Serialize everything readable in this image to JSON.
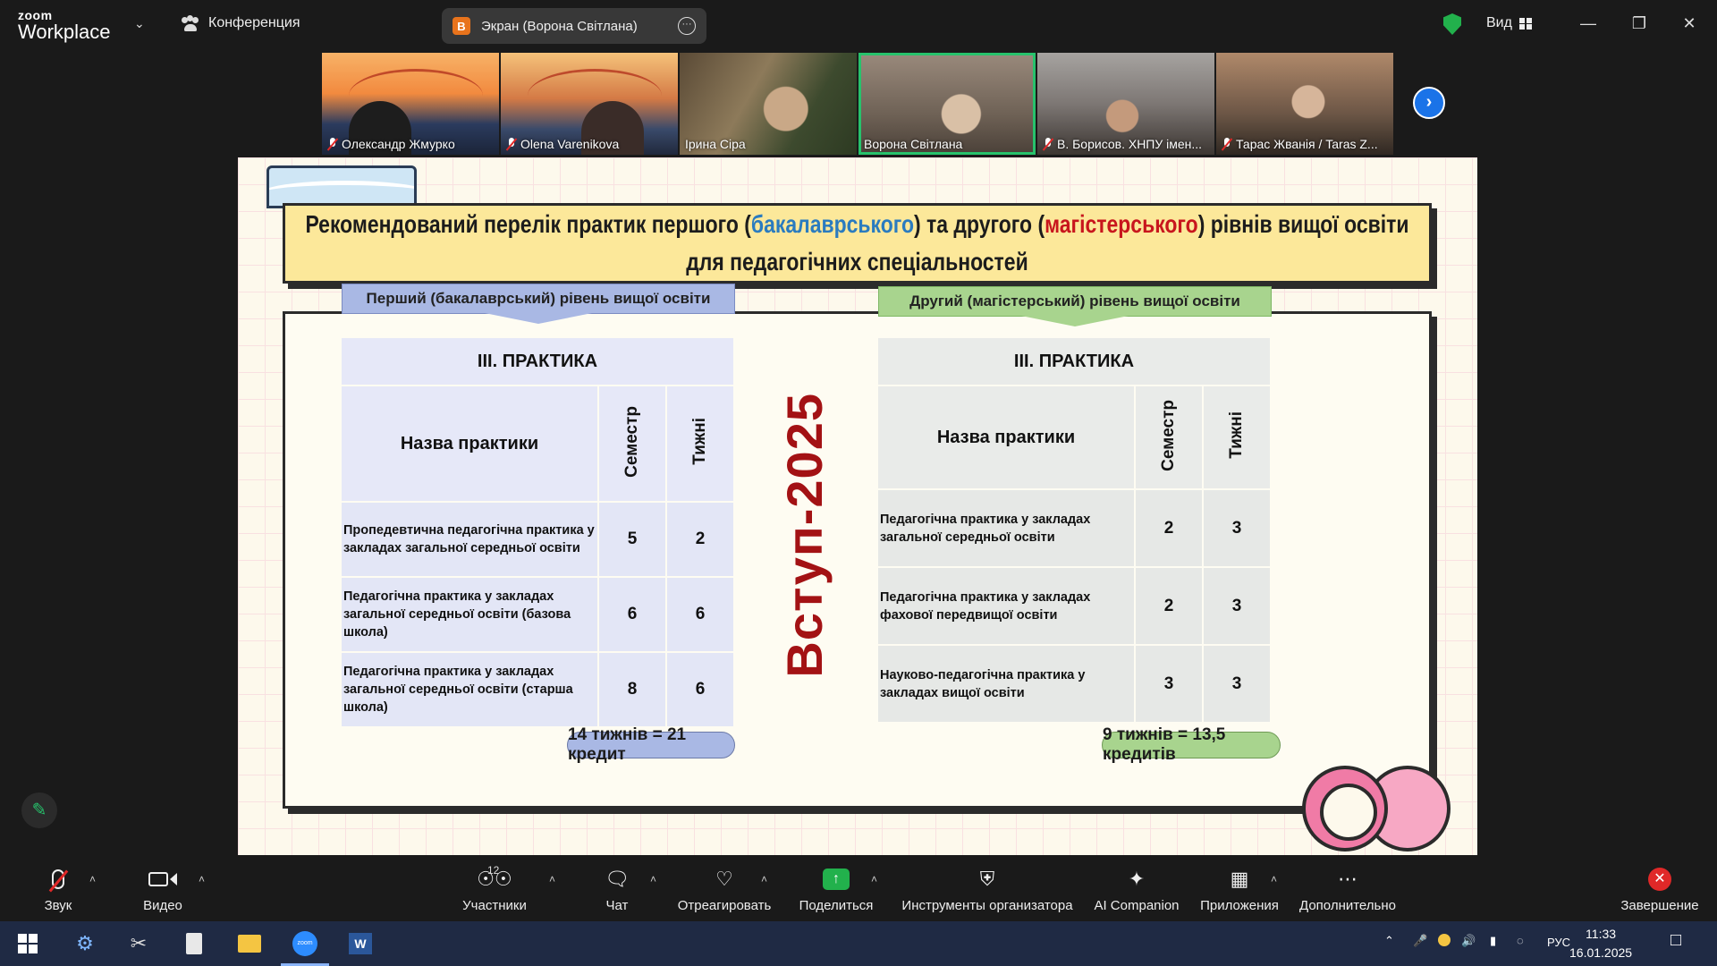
{
  "app": {
    "logo_top": "zoom",
    "logo_bottom": "Workplace",
    "conference_label": "Конференция",
    "screen_pill": {
      "avatar_letter": "В",
      "label": "Экран (Ворона Світлана)"
    },
    "view_label": "Вид"
  },
  "participants": [
    {
      "name": "Олександр Жмурко",
      "muted": true
    },
    {
      "name": "Olena Varenikova",
      "muted": true
    },
    {
      "name": "Ірина Сіра",
      "muted": false
    },
    {
      "name": "Ворона Світлана",
      "muted": false,
      "active": true
    },
    {
      "name": "В. Борисов. ХНПУ імен...",
      "muted": true
    },
    {
      "name": "Тарас Жванія / Taras Z...",
      "muted": true
    }
  ],
  "slide": {
    "title_pre": "Рекомендований перелік практик першого (",
    "title_blue": "бакалаврського",
    "title_mid": ") та другого (",
    "title_red": "магістерського",
    "title_post": ") рівнів вищої освіти",
    "title_line2": "для педагогічних спеціальностей",
    "level1": "Перший (бакалаврський) рівень вищої освіти",
    "level2": "Другий (магістерський) рівень вищої освіти",
    "vertical_text": "Вступ-2025",
    "table1": {
      "section": "ІІІ. ПРАКТИКА",
      "col_name": "Назва практики",
      "col_sem": "Семестр",
      "col_weeks": "Тижні",
      "rows": [
        {
          "name": "Пропедевтична педагогічна практика у закладах загальної середньої освіти",
          "sem": "5",
          "weeks": "2"
        },
        {
          "name": "Педагогічна практика у закладах загальної середньої освіти (базова школа)",
          "sem": "6",
          "weeks": "6"
        },
        {
          "name": "Педагогічна практика у закладах загальної середньої освіти (старша школа)",
          "sem": "8",
          "weeks": "6"
        }
      ],
      "total": "14 тижнів = 21 кредит"
    },
    "table2": {
      "section": "ІІІ. ПРАКТИКА",
      "col_name": "Назва практики",
      "col_sem": "Семестр",
      "col_weeks": "Тижні",
      "rows": [
        {
          "name": "Педагогічна практика у закладах загальної середньої освіти",
          "sem": "2",
          "weeks": "3"
        },
        {
          "name": "Педагогічна практика у закладах фахової передвищої освіти",
          "sem": "2",
          "weeks": "3"
        },
        {
          "name": "Науково-педагогічна практика у закладах вищої освіти",
          "sem": "3",
          "weeks": "3"
        }
      ],
      "total": "9 тижнів = 13,5 кредитів"
    }
  },
  "toolbar": {
    "audio": "Звук",
    "video": "Видео",
    "participants": "Участники",
    "participants_count": "12",
    "chat": "Чат",
    "react": "Отреагировать",
    "share": "Поделиться",
    "host_tools": "Инструменты организатора",
    "ai": "AI Companion",
    "apps": "Приложения",
    "more": "Дополнительно",
    "end": "Завершение"
  },
  "taskbar": {
    "lang": "РУС",
    "time": "11:33",
    "date": "16.01.2025"
  },
  "colors": {
    "accent_green": "#22b14c",
    "end_red": "#e02828",
    "title_blue": "#2a7bbf",
    "title_red": "#c8161d",
    "vstup_red": "#a31214"
  }
}
